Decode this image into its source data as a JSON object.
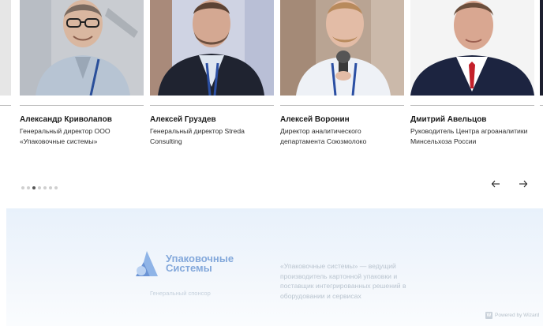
{
  "speakers": [
    {
      "name": "Александр Криволапов",
      "role": "Генеральный директор ООО «Упаковочные системы»"
    },
    {
      "name": "Алексей Груздев",
      "role": "Генеральный директор Streda Consulting"
    },
    {
      "name": "Алексей Воронин",
      "role": "Директор аналитического департамента Союзмолоко"
    },
    {
      "name": "Дмитрий Авельцов",
      "role": "Руководитель Центра агроаналитики Минсельхоза России"
    }
  ],
  "carousel": {
    "page_count": 7,
    "active_index": 2
  },
  "sponsor": {
    "logo_line1": "Упаковочные",
    "logo_line2": "Системы",
    "caption": "Генеральный спонсор",
    "description": "«Упаковочные системы» — ведущий производитель картонной упаковки и поставщик интегрированных решений в оборудовании и сервисах"
  },
  "footer": {
    "powered_by": "Powered by Wizard"
  },
  "colors": {
    "accent": "#5f8fd0",
    "rule": "#b9b9b9",
    "sponsor_bg": "#e8f1fb"
  }
}
